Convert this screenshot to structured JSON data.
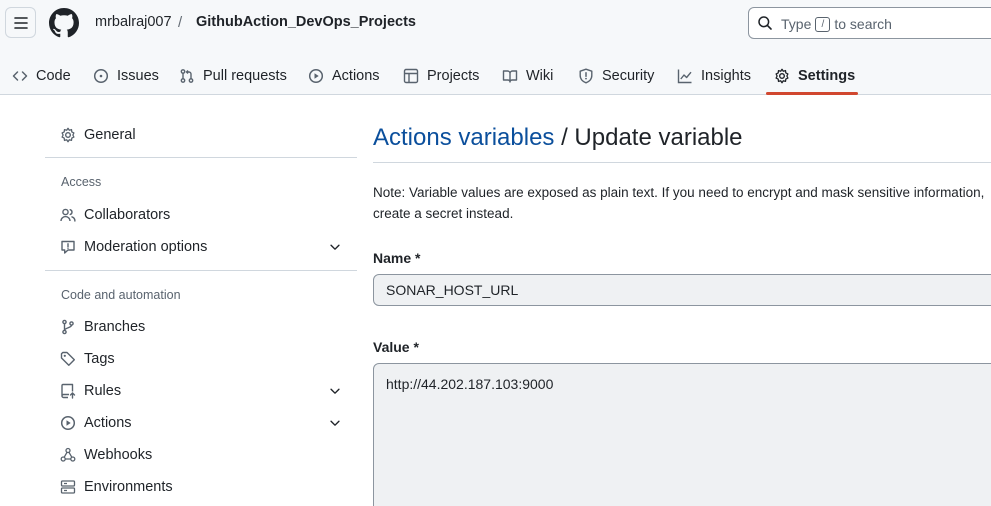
{
  "header": {
    "owner": "mrbalraj007",
    "separator": "/",
    "repo": "GithubAction_DevOps_Projects",
    "search": {
      "prefix": "Type",
      "key": "/",
      "suffix": "to search"
    }
  },
  "tabs": [
    {
      "label": "Code",
      "icon": "code-icon"
    },
    {
      "label": "Issues",
      "icon": "issue-icon"
    },
    {
      "label": "Pull requests",
      "icon": "pull-request-icon"
    },
    {
      "label": "Actions",
      "icon": "play-icon"
    },
    {
      "label": "Projects",
      "icon": "table-icon"
    },
    {
      "label": "Wiki",
      "icon": "book-icon"
    },
    {
      "label": "Security",
      "icon": "shield-icon"
    },
    {
      "label": "Insights",
      "icon": "graph-icon"
    },
    {
      "label": "Settings",
      "icon": "gear-icon",
      "selected": true
    }
  ],
  "sidebar": {
    "general": "General",
    "access_heading": "Access",
    "collaborators": "Collaborators",
    "moderation": "Moderation options",
    "automation_heading": "Code and automation",
    "branches": "Branches",
    "tags": "Tags",
    "rules": "Rules",
    "actions": "Actions",
    "webhooks": "Webhooks",
    "environments": "Environments"
  },
  "main": {
    "title_link": "Actions variables",
    "title_rest": " / Update variable",
    "note": "Note: Variable values are exposed as plain text. If you need to encrypt and mask sensitive information, create a secret instead.",
    "name_label": "Name *",
    "name_value": "SONAR_HOST_URL",
    "value_label": "Value *",
    "value_value": "http://44.202.187.103:9000"
  },
  "colors": {
    "accent_link": "#0b4f9c",
    "tab_underline": "#d1472f"
  }
}
